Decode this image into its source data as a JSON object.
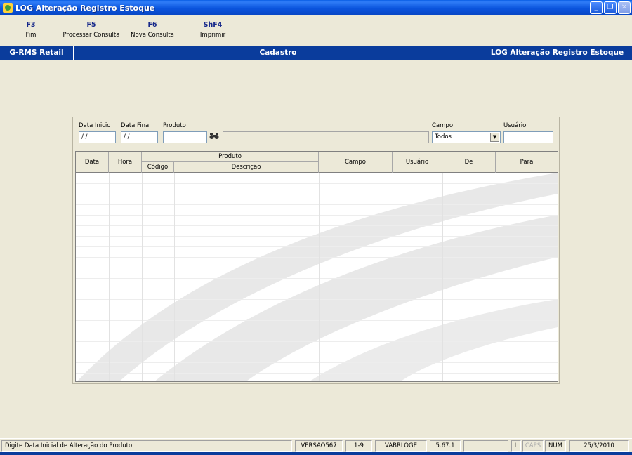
{
  "window": {
    "title": "LOG Alteração Registro Estoque",
    "minimize": "_",
    "restore": "❐",
    "close": "✕"
  },
  "toolbar": [
    {
      "key": "F3",
      "label": "Fim"
    },
    {
      "key": "F5",
      "label": "Processar Consulta"
    },
    {
      "key": "F6",
      "label": "Nova Consulta"
    },
    {
      "key": "ShF4",
      "label": "Imprimir"
    }
  ],
  "header": {
    "left": "G-RMS Retail",
    "center": "Cadastro",
    "right": "LOG Alteração Registro Estoque"
  },
  "filters": {
    "data_inicio": {
      "label": "Data Inicio",
      "value": "/ /"
    },
    "data_final": {
      "label": "Data Final",
      "value": "/ /"
    },
    "produto": {
      "label": "Produto",
      "value": "",
      "description": ""
    },
    "campo": {
      "label": "Campo",
      "value": "Todos"
    },
    "usuario": {
      "label": "Usuário",
      "value": ""
    }
  },
  "grid": {
    "columns": {
      "data": "Data",
      "hora": "Hora",
      "produto": "Produto",
      "codigo": "Código",
      "descricao": "Descrição",
      "campo": "Campo",
      "usuario": "Usuário",
      "de": "De",
      "para": "Para"
    },
    "rows": []
  },
  "statusbar": {
    "message": "Digite Data Inicial de Alteração do Produto",
    "versao": "VERSAO567",
    "range": "1-9",
    "program": "VABRLOGE",
    "release": "5.67.1",
    "blank": "",
    "l": "L",
    "caps": "CAPS",
    "num": "NUM",
    "date": "25/3/2010"
  },
  "colors": {
    "title_bar": "#0a54dd",
    "header_bar": "#0a3c9c",
    "fkey_text": "#16288a",
    "background": "#ece9d8"
  }
}
